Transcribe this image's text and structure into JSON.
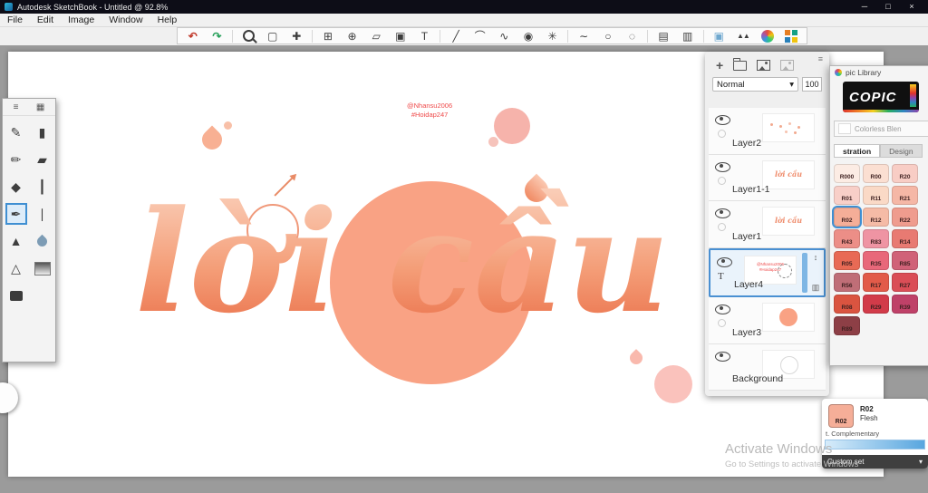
{
  "window": {
    "title": "Autodesk SketchBook - Untitled @ 92.8%",
    "minimize": "─",
    "maximize": "□",
    "close": "×"
  },
  "menu": {
    "items": [
      "File",
      "Edit",
      "Image",
      "Window",
      "Help"
    ]
  },
  "toolbar": {
    "tools": [
      {
        "name": "undo",
        "glyph": "↶"
      },
      {
        "name": "redo",
        "glyph": "↷"
      },
      {
        "name": "zoom",
        "glyph": ""
      },
      {
        "name": "selection",
        "glyph": "▢"
      },
      {
        "name": "magic-selection",
        "glyph": "✚"
      },
      {
        "name": "crop",
        "glyph": "⊞"
      },
      {
        "name": "transform",
        "glyph": "⊕"
      },
      {
        "name": "distort",
        "glyph": "▱"
      },
      {
        "name": "fill",
        "glyph": "▣"
      },
      {
        "name": "text",
        "glyph": "T"
      },
      {
        "name": "ruler",
        "glyph": "╱"
      },
      {
        "name": "ellipse-guide",
        "glyph": "⌒"
      },
      {
        "name": "french-curve",
        "glyph": "∿"
      },
      {
        "name": "perspective-guide",
        "glyph": "◉"
      },
      {
        "name": "symmetry",
        "glyph": "✳"
      },
      {
        "name": "steady-stroke",
        "glyph": "∼"
      },
      {
        "name": "shape-circle",
        "glyph": "○"
      },
      {
        "name": "shape-lasso",
        "glyph": "◌"
      },
      {
        "name": "import-image",
        "glyph": "▤"
      },
      {
        "name": "flipbook",
        "glyph": "▥"
      },
      {
        "name": "layer-editor",
        "glyph": "▣"
      },
      {
        "name": "brush-library",
        "glyph": "▲▲"
      },
      {
        "name": "color-editor",
        "glyph": ""
      },
      {
        "name": "color-swatches",
        "glyph": ""
      }
    ]
  },
  "left_palette": {
    "handles": [
      {
        "name": "sliders",
        "glyph": "≡"
      },
      {
        "name": "grid",
        "glyph": "▦"
      }
    ],
    "tools": [
      {
        "name": "paintbrush",
        "glyph": "✎"
      },
      {
        "name": "airbrush",
        "glyph": "▮"
      },
      {
        "name": "pencil",
        "glyph": "✏"
      },
      {
        "name": "marker",
        "glyph": "▰"
      },
      {
        "name": "chisel-pen",
        "glyph": "◆"
      },
      {
        "name": "ballpoint-pen",
        "glyph": "┃"
      },
      {
        "name": "fountain-pen",
        "glyph": "✒",
        "selected": true
      },
      {
        "name": "ink-pen",
        "glyph": "∣"
      },
      {
        "name": "smudge",
        "glyph": "▲"
      },
      {
        "name": "water-drop",
        "glyph": ""
      },
      {
        "name": "triangle",
        "glyph": "△"
      },
      {
        "name": "gradient-fill",
        "glyph": ""
      },
      {
        "name": "eraser",
        "glyph": ""
      }
    ]
  },
  "canvas": {
    "credit_line1": "@Nhansu2006",
    "credit_line2": "#Hoidap247",
    "artwork_text": "lời cầu",
    "circle_color": "#f9a284"
  },
  "layers_panel": {
    "add_label": "+",
    "blend_mode": "Normal",
    "blend_caret": "▾",
    "opacity": "100",
    "layers": [
      {
        "name": "Layer2"
      },
      {
        "name": "Layer1-1"
      },
      {
        "name": "Layer1"
      },
      {
        "name": "Layer4",
        "selected": true,
        "type_glyph": "T"
      },
      {
        "name": "Layer3"
      },
      {
        "name": "Background"
      }
    ]
  },
  "copic": {
    "title": "pic Library",
    "logo": "COPIC",
    "colorless_label": "Colorless Blen",
    "tabs": [
      "stration",
      "Design"
    ],
    "swatches": [
      {
        "code": "R000",
        "color": "#fcece4"
      },
      {
        "code": "R00",
        "color": "#fbdfd2"
      },
      {
        "code": "R20",
        "color": "#f8cdc5"
      },
      {
        "code": "R01",
        "color": "#f8cfc8"
      },
      {
        "code": "R11",
        "color": "#fad9c6"
      },
      {
        "code": "R21",
        "color": "#f5b7a6"
      },
      {
        "code": "R02",
        "color": "#f5ae98",
        "selected": true
      },
      {
        "code": "R12",
        "color": "#f5bba6"
      },
      {
        "code": "R22",
        "color": "#ef9c8e"
      },
      {
        "code": "R43",
        "color": "#ec8e87"
      },
      {
        "code": "R83",
        "color": "#ef94a3"
      },
      {
        "code": "R14",
        "color": "#e87a72"
      },
      {
        "code": "R05",
        "color": "#e86a55"
      },
      {
        "code": "R35",
        "color": "#e8687a"
      },
      {
        "code": "R85",
        "color": "#d06278"
      },
      {
        "code": "R56",
        "color": "#bf6e77"
      },
      {
        "code": "R17",
        "color": "#e25b49"
      },
      {
        "code": "R27",
        "color": "#da4e57"
      },
      {
        "code": "R08",
        "color": "#da5440"
      },
      {
        "code": "R29",
        "color": "#d23b49"
      },
      {
        "code": "R39",
        "color": "#bf4168"
      },
      {
        "code": "R89",
        "color": "#8d3f46"
      }
    ]
  },
  "color_info": {
    "code": "R02",
    "name": "Flesh",
    "note": "t. Complementary",
    "set_label": "Custom set",
    "caret": "▾",
    "swatch_color": "#f5ae98"
  },
  "watermark": {
    "line1": "Activate Windows",
    "line2": "Go to Settings to activate Windows"
  }
}
